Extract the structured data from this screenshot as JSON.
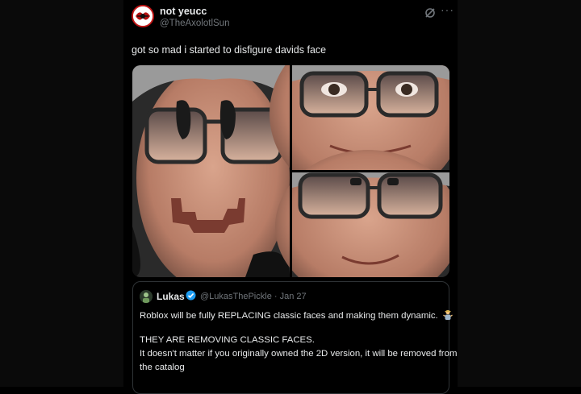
{
  "author": {
    "display_name": "not yeucc",
    "handle": "@TheAxolotlSun"
  },
  "post": {
    "text": "got so mad i started to disfigure davids face"
  },
  "icons": {
    "grok": "grok-icon",
    "more": "more-icon",
    "verified": "verified-badge-icon",
    "emoji": "man-shrugging-emoji"
  },
  "more_glyph": "···",
  "quoted_post": {
    "display_name": "Lukas",
    "handle": "@LukasThePickle",
    "separator": "·",
    "date": "Jan 27",
    "line1": "Roblox will be fully REPLACING classic faces and making them dynamic.",
    "line2": "THEY ARE REMOVING CLASSIC FACES.",
    "line3": "It doesn't matter if you originally owned the 2D version, it will be removed from",
    "line4": "the catalog"
  },
  "colors": {
    "background": "#000000",
    "text_primary": "#e7e9ea",
    "text_secondary": "#71767b",
    "verified_blue": "#1d9bf0",
    "border": "#2f3336"
  }
}
